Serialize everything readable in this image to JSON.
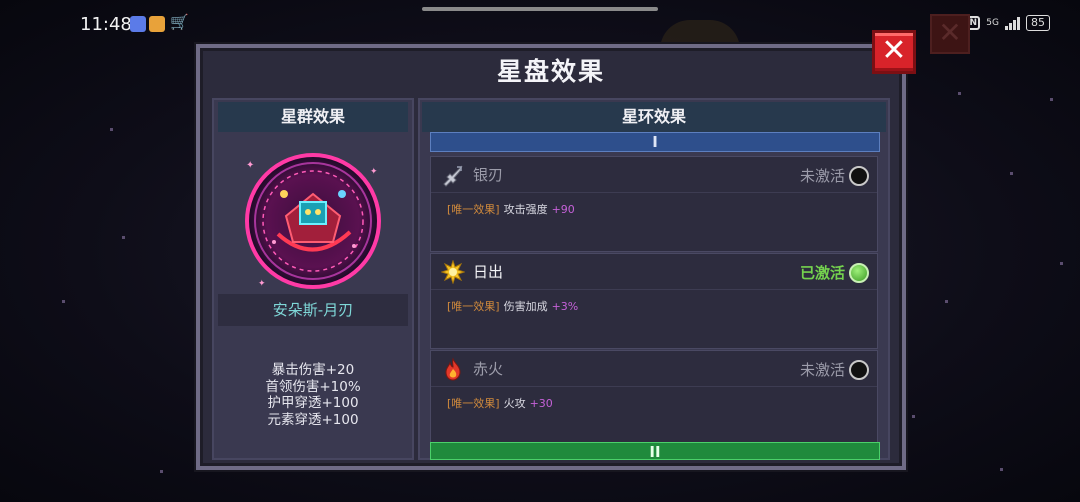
{
  "status_bar": {
    "time": "11:48",
    "network": "5G",
    "battery": "85"
  },
  "dialog": {
    "title": "星盘效果",
    "close_icon": "close-x-icon"
  },
  "constellation_panel": {
    "header": "星群效果",
    "character_name": "安朵斯-月刃",
    "bonuses": [
      "暴击伤害+20",
      "首领伤害+10%",
      "护甲穿透+100",
      "元素穿透+100"
    ]
  },
  "ring_panel": {
    "header": "星环效果",
    "tiers": [
      {
        "label": "I",
        "effects": [
          {
            "name": "银刃",
            "icon": "silver-blade-icon",
            "status": "未激活",
            "active": false,
            "tag": "[唯一效果]",
            "stat": "攻击强度",
            "value": "+90"
          },
          {
            "name": "日出",
            "icon": "sunrise-icon",
            "status": "已激活",
            "active": true,
            "tag": "[唯一效果]",
            "stat": "伤害加成",
            "value": "+3%"
          },
          {
            "name": "赤火",
            "icon": "red-fire-icon",
            "status": "未激活",
            "active": false,
            "tag": "[唯一效果]",
            "stat": "火攻",
            "value": "+30"
          }
        ]
      },
      {
        "label": "II"
      }
    ]
  },
  "colors": {
    "accent_active": "#74d24e",
    "tag_orange": "#d08a3c",
    "value_purple": "#c561d8",
    "name_cyan": "#7fd8d8"
  }
}
